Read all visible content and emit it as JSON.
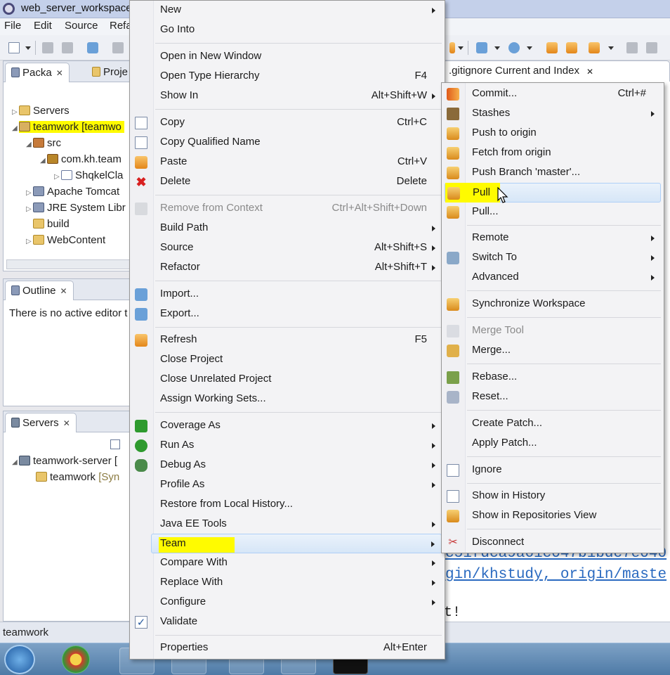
{
  "window": {
    "title": "web_server_workspace"
  },
  "menubar": [
    "File",
    "Edit",
    "Source",
    "Refa"
  ],
  "package_explorer": {
    "tabs": [
      {
        "label": "Packa"
      },
      {
        "label": "Proje"
      }
    ],
    "tree": [
      {
        "label": "Servers"
      },
      {
        "label": "teamwork [teamwo"
      },
      {
        "label": "src"
      },
      {
        "label": "com.kh.team"
      },
      {
        "label": "ShqkelCla"
      },
      {
        "label": "Apache Tomcat"
      },
      {
        "label": "JRE System Libr"
      },
      {
        "label": "build"
      },
      {
        "label": "WebContent"
      }
    ]
  },
  "outline": {
    "tab": "Outline",
    "message": "There is no active editor t"
  },
  "servers_view": {
    "tab": "Servers",
    "server": "teamwork-server",
    "server_suffix": "[",
    "module": "teamwork",
    "module_state": "[Syn"
  },
  "status_bar": {
    "text": "teamwork"
  },
  "editor": {
    "tab": ".gitignore Current and Index",
    "lines": [
      "c51fdca9a61c047b1bdc7e040",
      "gin/khstudy, origin/maste",
      "t!"
    ],
    "right_fragments": [
      "ç",
      "t!"
    ]
  },
  "context_menu": {
    "items": [
      {
        "label": "New",
        "submenu": true
      },
      {
        "label": "Go Into"
      },
      {
        "label": "Open in New Window"
      },
      {
        "label": "Open Type Hierarchy",
        "accel": "F4"
      },
      {
        "label": "Show In",
        "accel": "Alt+Shift+W",
        "submenu": true
      },
      {
        "label": "Copy",
        "accel": "Ctrl+C",
        "icon": "copy-icon"
      },
      {
        "label": "Copy Qualified Name",
        "icon": "copy-qualified-icon"
      },
      {
        "label": "Paste",
        "accel": "Ctrl+V",
        "icon": "paste-icon"
      },
      {
        "label": "Delete",
        "accel": "Delete",
        "icon": "delete-icon"
      },
      {
        "label": "Remove from Context",
        "accel": "Ctrl+Alt+Shift+Down",
        "disabled": true,
        "icon": "remove-context-icon"
      },
      {
        "label": "Build Path",
        "submenu": true
      },
      {
        "label": "Source",
        "accel": "Alt+Shift+S",
        "submenu": true
      },
      {
        "label": "Refactor",
        "accel": "Alt+Shift+T",
        "submenu": true
      },
      {
        "label": "Import...",
        "icon": "import-icon"
      },
      {
        "label": "Export...",
        "icon": "export-icon"
      },
      {
        "label": "Refresh",
        "accel": "F5",
        "icon": "refresh-icon"
      },
      {
        "label": "Close Project"
      },
      {
        "label": "Close Unrelated Project"
      },
      {
        "label": "Assign Working Sets..."
      },
      {
        "label": "Coverage As",
        "submenu": true,
        "icon": "coverage-icon"
      },
      {
        "label": "Run As",
        "submenu": true,
        "icon": "run-icon"
      },
      {
        "label": "Debug As",
        "submenu": true,
        "icon": "debug-icon"
      },
      {
        "label": "Profile As",
        "submenu": true
      },
      {
        "label": "Restore from Local History..."
      },
      {
        "label": "Java EE Tools",
        "submenu": true
      },
      {
        "label": "Team",
        "submenu": true,
        "highlighted": true
      },
      {
        "label": "Compare With",
        "submenu": true
      },
      {
        "label": "Replace With",
        "submenu": true
      },
      {
        "label": "Configure",
        "submenu": true
      },
      {
        "label": "Validate",
        "icon": "checkbox-icon"
      },
      {
        "label": "Properties",
        "accel": "Alt+Enter"
      }
    ]
  },
  "team_menu": {
    "items": [
      {
        "label": "Commit...",
        "accel": "Ctrl+#",
        "icon": "commit-icon"
      },
      {
        "label": "Stashes",
        "submenu": true,
        "icon": "stashes-icon"
      },
      {
        "label": "Push to origin",
        "icon": "push-icon"
      },
      {
        "label": "Fetch from origin",
        "icon": "fetch-icon"
      },
      {
        "label": "Push Branch 'master'...",
        "icon": "push-branch-icon"
      },
      {
        "label": "Pull",
        "icon": "pull-icon",
        "highlighted": true
      },
      {
        "label": "Pull...",
        "icon": "pull-dialog-icon"
      },
      {
        "label": "Remote",
        "submenu": true
      },
      {
        "label": "Switch To",
        "submenu": true,
        "icon": "switch-icon"
      },
      {
        "label": "Advanced",
        "submenu": true
      },
      {
        "label": "Synchronize Workspace",
        "icon": "synchronize-icon"
      },
      {
        "label": "Merge Tool",
        "disabled": true,
        "icon": "merge-tool-icon"
      },
      {
        "label": "Merge...",
        "icon": "merge-icon"
      },
      {
        "label": "Rebase...",
        "icon": "rebase-icon"
      },
      {
        "label": "Reset...",
        "icon": "reset-icon"
      },
      {
        "label": "Create Patch..."
      },
      {
        "label": "Apply Patch..."
      },
      {
        "label": "Ignore",
        "icon": "ignore-icon"
      },
      {
        "label": "Show in History",
        "icon": "history-icon"
      },
      {
        "label": "Show in Repositories View",
        "icon": "repositories-icon"
      },
      {
        "label": "Disconnect",
        "icon": "disconnect-icon"
      }
    ]
  },
  "colors": {
    "highlight": "#fffb00",
    "menu_bg": "#f3f3f5",
    "hover": "#d6e6f7"
  }
}
